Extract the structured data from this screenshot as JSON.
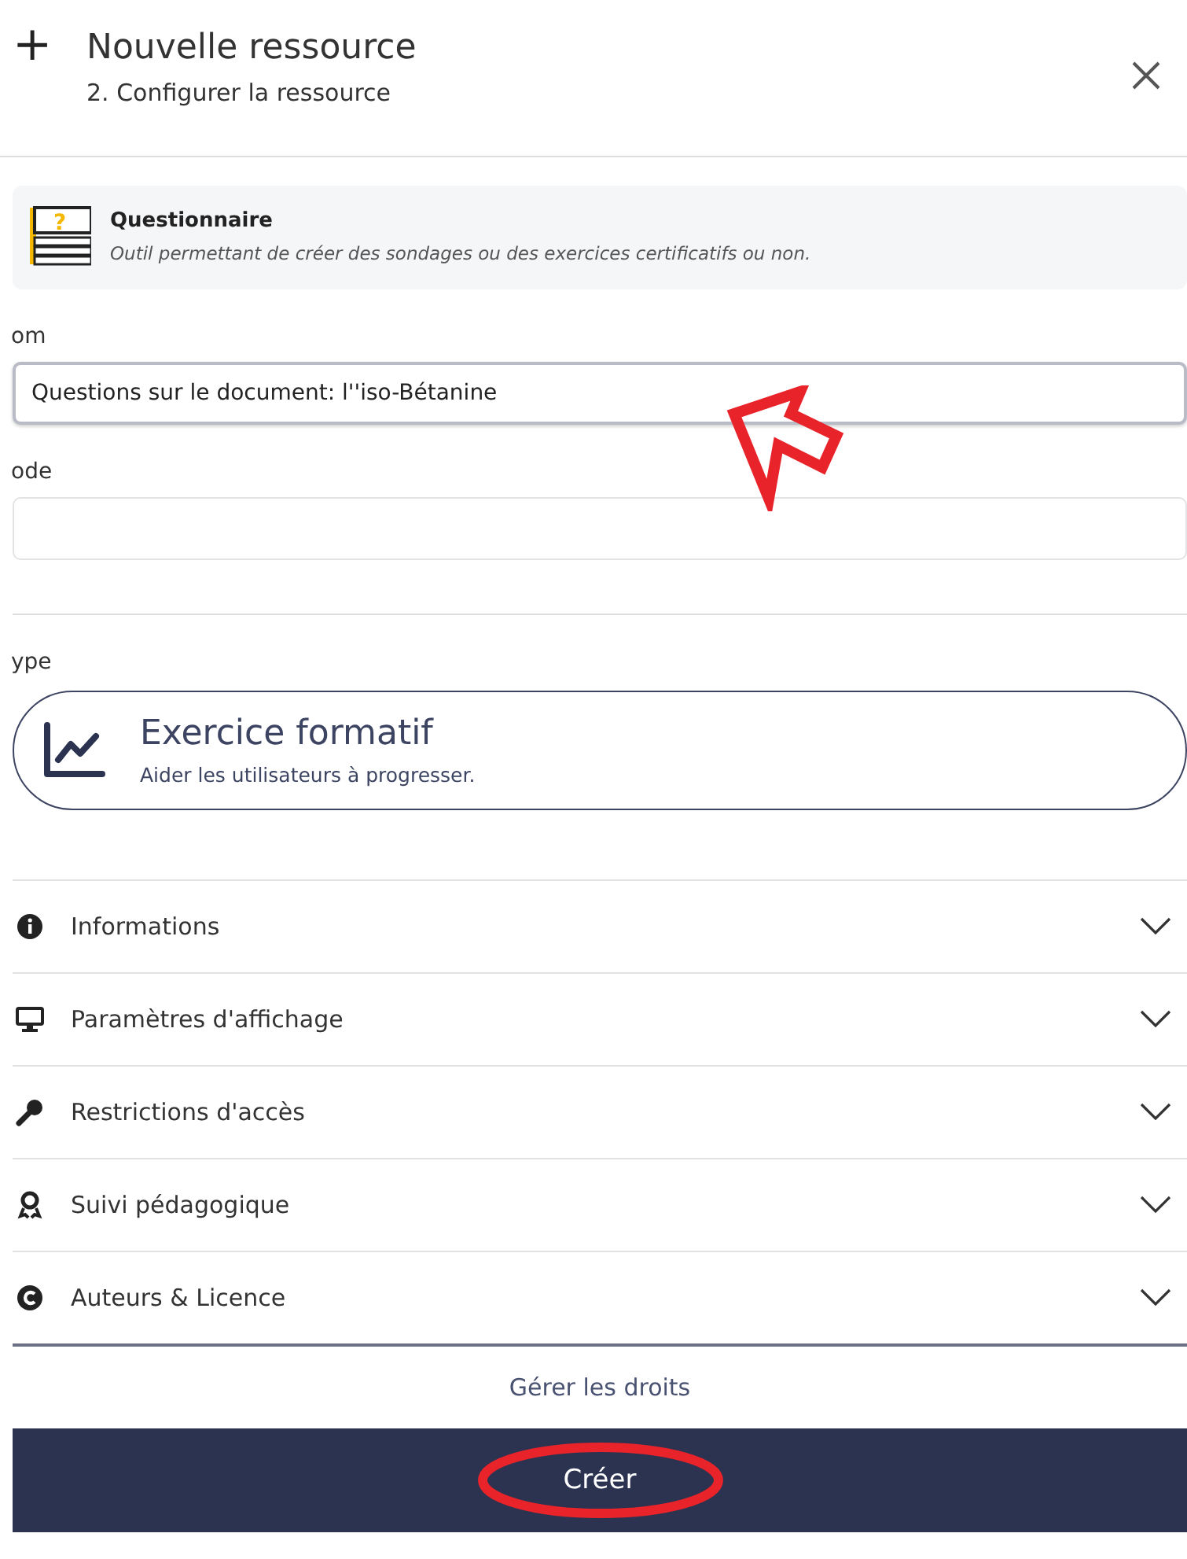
{
  "header": {
    "icon": "+",
    "title": "Nouvelle ressource",
    "subtitle": "2. Configurer la ressource"
  },
  "resource": {
    "icon_glyph": "?",
    "name": "Questionnaire",
    "description": "Outil permettant de créer des sondages ou des exercices certificatifs ou non."
  },
  "fields": [
    {
      "label": "om",
      "value": "Questions sur le document: l''iso-Bétanine",
      "focused": true
    },
    {
      "label": "ode",
      "focused": false
    }
  ],
  "type": {
    "label": "ype",
    "title": "Exercice formatif",
    "description": "Aider les utilisateurs à progresser."
  },
  "sections": [
    {
      "kind": "info",
      "label": "Informations",
      "expanded": false
    },
    {
      "kind": "display",
      "label": "Paramètres d'affichage",
      "expanded": false
    },
    {
      "kind": "key",
      "label": "Restrictions d'accès",
      "expanded": false
    },
    {
      "kind": "badge",
      "label": "Suivi pédagogique",
      "expanded": false
    },
    {
      "kind": "copyright",
      "label": "Auteurs & Licence",
      "expanded": false
    }
  ],
  "rights_link": "Gérer les droits",
  "submit": "Créer"
}
